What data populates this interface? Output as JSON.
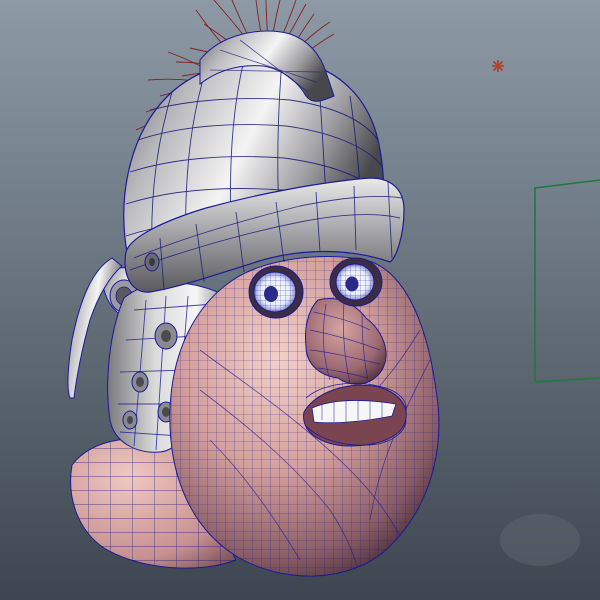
{
  "viewport": {
    "background_top": "#8d9aa6",
    "background_bottom": "#3d4650"
  },
  "model": {
    "skin_color": "#e8b9b2",
    "skin_shadow": "#4b2a34",
    "metal_light": "#f2f2f2",
    "metal_dark": "#3c3c40",
    "wire_color": "#1a1a9a",
    "hair_color": "#8a1010"
  },
  "scene": {
    "light_marker_color": "#b03018",
    "camera_frame_color": "#1f7a3c"
  }
}
